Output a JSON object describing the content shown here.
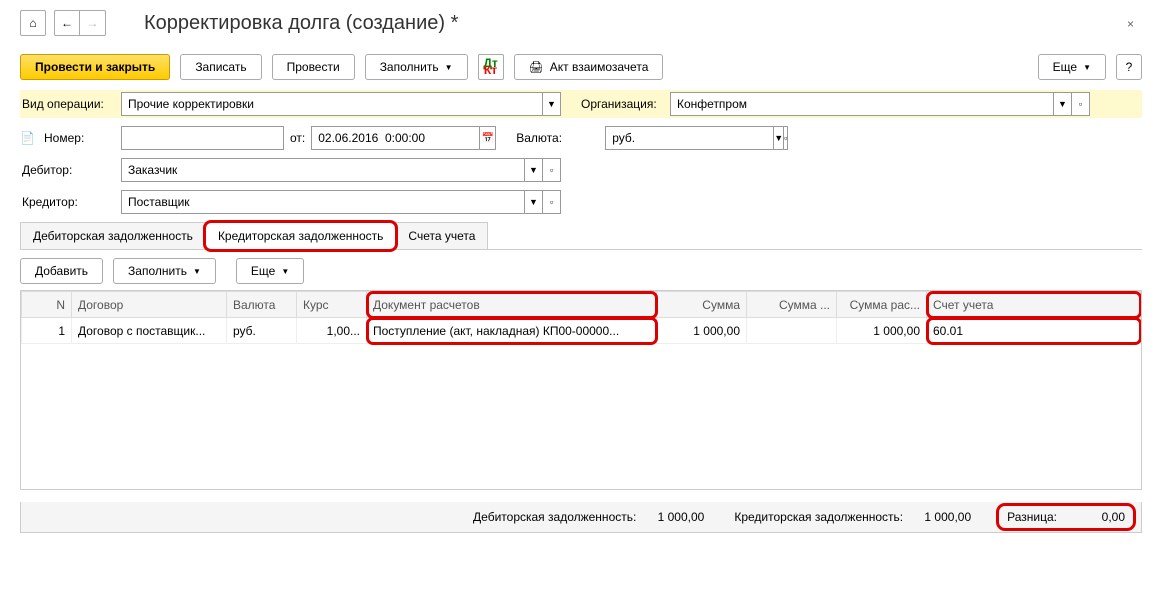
{
  "header": {
    "title": "Корректировка долга (создание) *"
  },
  "toolbar": {
    "submit_close": "Провести и закрыть",
    "write": "Записать",
    "submit": "Провести",
    "fill": "Заполнить",
    "act": "Акт взаимозачета",
    "more": "Еще",
    "help": "?"
  },
  "fields": {
    "op_type_label": "Вид операции:",
    "op_type_value": "Прочие корректировки",
    "org_label": "Организация:",
    "org_value": "Конфетпром",
    "number_label": "Номер:",
    "number_value": "",
    "date_from_label": "от:",
    "date_value": "02.06.2016  0:00:00",
    "currency_label": "Валюта:",
    "currency_value": "руб.",
    "debtor_label": "Дебитор:",
    "debtor_value": "Заказчик",
    "creditor_label": "Кредитор:",
    "creditor_value": "Поставщик"
  },
  "tabs": {
    "t1": "Дебиторская задолженность",
    "t2": "Кредиторская задолженность",
    "t3": "Счета учета"
  },
  "table_toolbar": {
    "add": "Добавить",
    "fill": "Заполнить",
    "more": "Еще"
  },
  "grid": {
    "headers": {
      "n": "N",
      "contract": "Договор",
      "currency": "Валюта",
      "rate": "Курс",
      "doc": "Документ расчетов",
      "sum": "Сумма",
      "sum2": "Сумма ...",
      "sum3": "Сумма рас...",
      "account": "Счет учета"
    },
    "rows": [
      {
        "n": "1",
        "contract": "Договор с поставщик...",
        "currency": "руб.",
        "rate": "1,00...",
        "doc": "Поступление (акт, накладная) КП00-00000...",
        "sum": "1 000,00",
        "sum2": "",
        "sum3": "1 000,00",
        "account": "60.01"
      }
    ]
  },
  "footer": {
    "deb_label": "Дебиторская задолженность:",
    "deb_value": "1 000,00",
    "cred_label": "Кредиторская задолженность:",
    "cred_value": "1 000,00",
    "diff_label": "Разница:",
    "diff_value": "0,00"
  }
}
